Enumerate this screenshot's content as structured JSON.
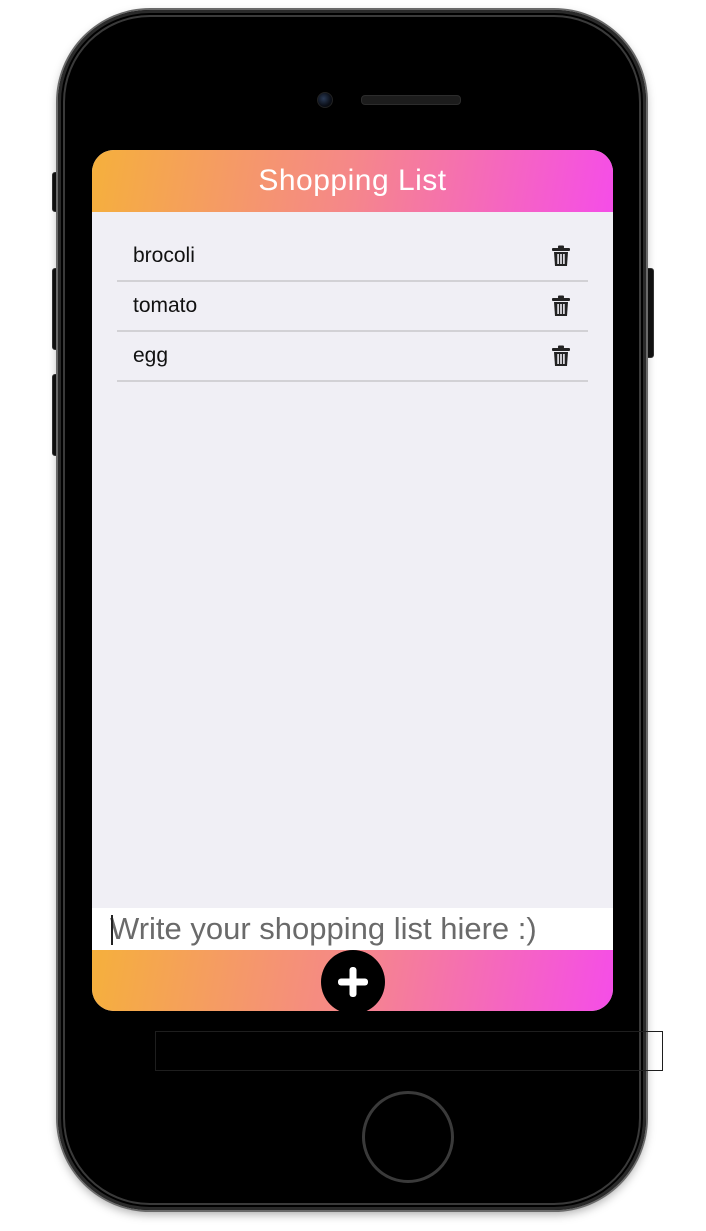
{
  "app": {
    "title": "Shopping List"
  },
  "items": [
    {
      "label": "brocoli",
      "action_icon": "trash-icon"
    },
    {
      "label": "tomato",
      "action_icon": "trash-icon"
    },
    {
      "label": "egg",
      "action_icon": "trash-icon"
    }
  ],
  "input": {
    "value": "",
    "placeholder": "Write your shopping list hiere :)"
  },
  "add_button": {
    "icon": "plus-icon"
  },
  "colors": {
    "gradient_start": "#f5b03c",
    "gradient_mid": "#f5878a",
    "gradient_end": "#f54de8",
    "screen_background": "#f0eff5",
    "phone_body": "#000000"
  }
}
